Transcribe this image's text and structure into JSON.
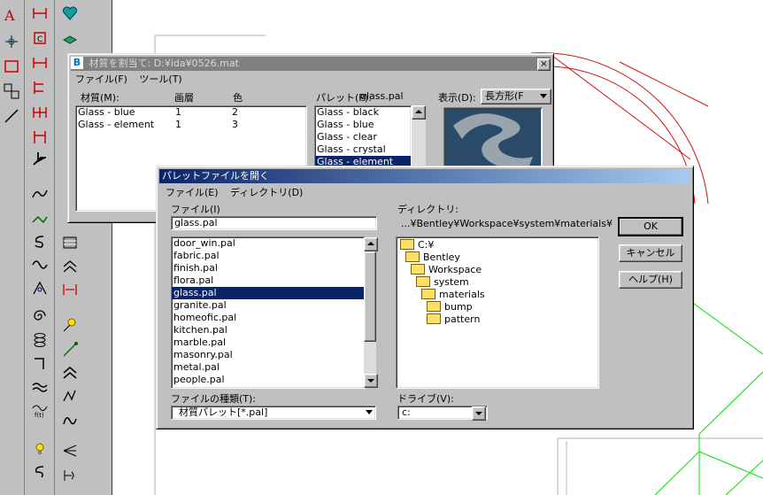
{
  "material_window": {
    "title": "材質を割当て: D:¥ida¥0526.mat",
    "menu": [
      "ファイル(F)",
      "ツール(T)"
    ],
    "col_material": "材質(M):",
    "col_level": "画層",
    "col_color": "色",
    "materials": [
      {
        "name": "Glass - blue",
        "level": "1",
        "color": "2"
      },
      {
        "name": "Glass - element",
        "level": "1",
        "color": "3"
      }
    ],
    "palette_label": "パレット(P):",
    "palette_value": "glass.pal",
    "palette_items": [
      "Glass - black",
      "Glass - blue",
      "Glass - clear",
      "Glass - crystal",
      "Glass - element"
    ],
    "palette_selected": 4,
    "display_label": "表示(D):",
    "display_value": "長方形(F"
  },
  "open_dialog": {
    "title": "パレットファイルを開く",
    "menu": [
      "ファイル(E)",
      "ディレクトリ(D)"
    ],
    "file_label": "ファイル(I)",
    "file_input": "glass.pal",
    "dir_label": "ディレクトリ:",
    "dir_path": "...¥Bentley¥Workspace¥system¥materials¥",
    "files": [
      "door_win.pal",
      "fabric.pal",
      "finish.pal",
      "flora.pal",
      "glass.pal",
      "granite.pal",
      "homeofic.pal",
      "kitchen.pal",
      "marble.pal",
      "masonry.pal",
      "metal.pal",
      "people.pal"
    ],
    "files_selected": 4,
    "tree": [
      {
        "name": "C:¥",
        "indent": 0
      },
      {
        "name": "Bentley",
        "indent": 1
      },
      {
        "name": "Workspace",
        "indent": 2
      },
      {
        "name": "system",
        "indent": 3
      },
      {
        "name": "materials",
        "indent": 4
      },
      {
        "name": "bump",
        "indent": 5
      },
      {
        "name": "pattern",
        "indent": 5
      }
    ],
    "filetype_label": "ファイルの種類(T):",
    "filetype_value": "材質パレット[*.pal]",
    "drive_label": "ドライブ(V):",
    "drive_value": "c:",
    "ok": "OK",
    "cancel": "キャンセル",
    "help": "ヘルプ(H)"
  },
  "colors": {
    "titlebar_active": "#0a246a",
    "titlebar_inactive": "#808080",
    "selection": "#0a246a",
    "cad_red": "#d01010",
    "cad_green": "#00e000"
  }
}
